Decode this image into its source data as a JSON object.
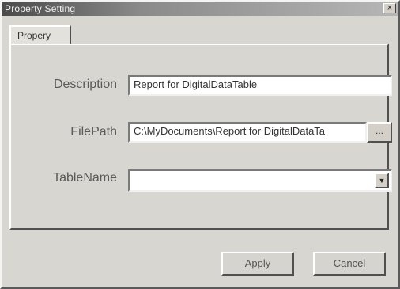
{
  "window": {
    "title": "Property Setting",
    "close_label": "×"
  },
  "tabs": [
    {
      "label": "Propery"
    }
  ],
  "form": {
    "description": {
      "label": "Description",
      "value": "Report for DigitalDataTable"
    },
    "filepath": {
      "label": "FilePath",
      "value": "C:\\MyDocuments\\Report for DigitalDataTa",
      "browse_label": "..."
    },
    "tablename": {
      "label": "TableName",
      "value": "",
      "dropdown_label": "▼"
    }
  },
  "buttons": {
    "apply": "Apply",
    "cancel": "Cancel"
  }
}
